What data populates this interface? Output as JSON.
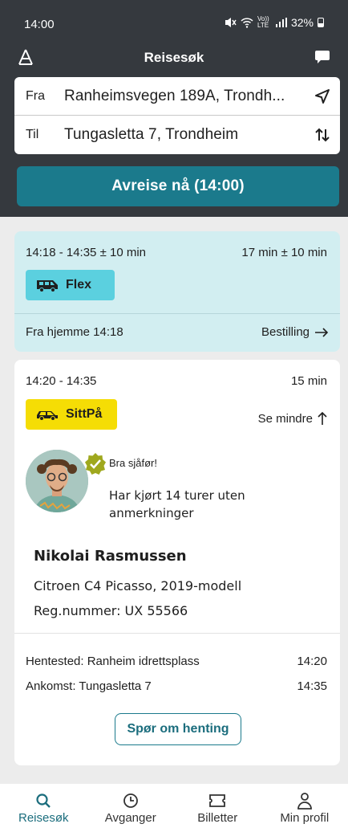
{
  "status": {
    "time": "14:00",
    "network": "Vo)) LTE",
    "battery": "32%"
  },
  "header": {
    "title": "Reisesøk"
  },
  "search": {
    "from_label": "Fra",
    "from_value": "Ranheimsvegen 189A, Trondh...",
    "to_label": "Til",
    "to_value": "Tungasletta 7, Trondheim"
  },
  "depart_button": "Avreise nå (14:00)",
  "flex_card": {
    "time_range": "14:18 - 14:35 ± 10 min",
    "duration": "17 min ± 10 min",
    "badge": "Flex",
    "from_home": "Fra hjemme 14:18",
    "order_link": "Bestilling"
  },
  "sitt_card": {
    "time_range": "14:20 - 14:35",
    "duration": "15 min",
    "badge": "SittPå",
    "see_less": "Se mindre",
    "praise": "Bra sjåfør!",
    "trips": "Har kjørt 14 turer uten anmerkninger",
    "driver_name": "Nikolai Rasmussen",
    "car": "Citroen C4 Picasso, 2019-modell",
    "reg": "Reg.nummer: UX 55566",
    "pickup_label": "Hentested: Ranheim idrettsplass",
    "pickup_time": "14:20",
    "arrival_label": "Ankomst: Tungasletta 7",
    "arrival_time": "14:35",
    "ask_button": "Spør om henting"
  },
  "nav": [
    {
      "label": "Reisesøk",
      "icon": "search-icon"
    },
    {
      "label": "Avganger",
      "icon": "clock-icon"
    },
    {
      "label": "Billetter",
      "icon": "ticket-icon"
    },
    {
      "label": "Min profil",
      "icon": "person-icon"
    }
  ],
  "colors": {
    "header": "#35393e",
    "accent": "#1b7a8c",
    "flex_bg": "#d2eef1",
    "flex_badge": "#5bd0df",
    "sitt_badge": "#f5dd05"
  }
}
